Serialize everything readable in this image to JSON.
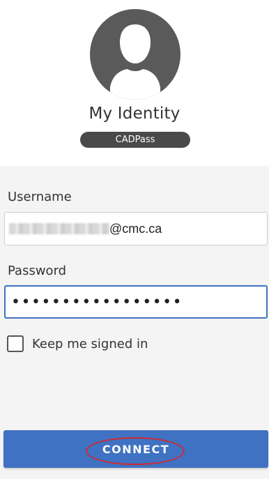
{
  "identity": {
    "title": "My Identity",
    "badge": "CADPass",
    "avatar_icon": "user-silhouette-icon"
  },
  "form": {
    "username_label": "Username",
    "username_domain": "@cmc.ca",
    "password_label": "Password",
    "password_value": "•••••••••••••••••",
    "remember_label": "Keep me signed in",
    "remember_checked": false,
    "connect_label": "CONNECT"
  },
  "colors": {
    "accent": "#3f72c2",
    "avatar": "#5a5a5a",
    "badge_bg": "#4a4a4a",
    "annotation": "#d0282f"
  }
}
